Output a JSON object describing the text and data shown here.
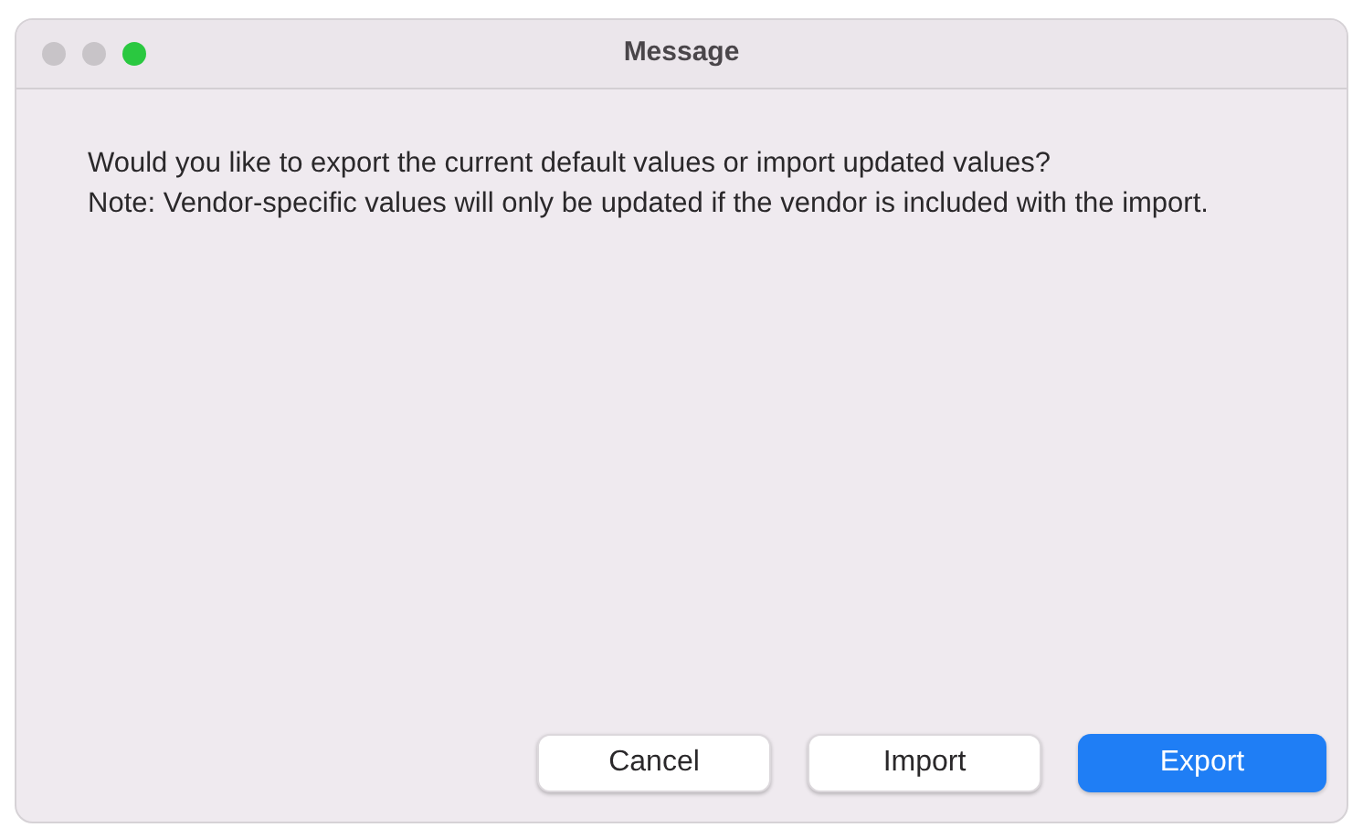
{
  "window": {
    "title": "Message",
    "lights": [
      {
        "color": "#c8c4c8"
      },
      {
        "color": "#c8c4c8"
      },
      {
        "color": "#2ac840"
      }
    ]
  },
  "message": [
    "Would you like to export the current default values or import updated values?",
    "Note: Vendor-specific values will only be updated if the vendor is included with the import."
  ],
  "buttons": [
    {
      "label": "Cancel",
      "kind": "plain"
    },
    {
      "label": "Import",
      "kind": "plain"
    },
    {
      "label": "Export",
      "kind": "default"
    }
  ]
}
